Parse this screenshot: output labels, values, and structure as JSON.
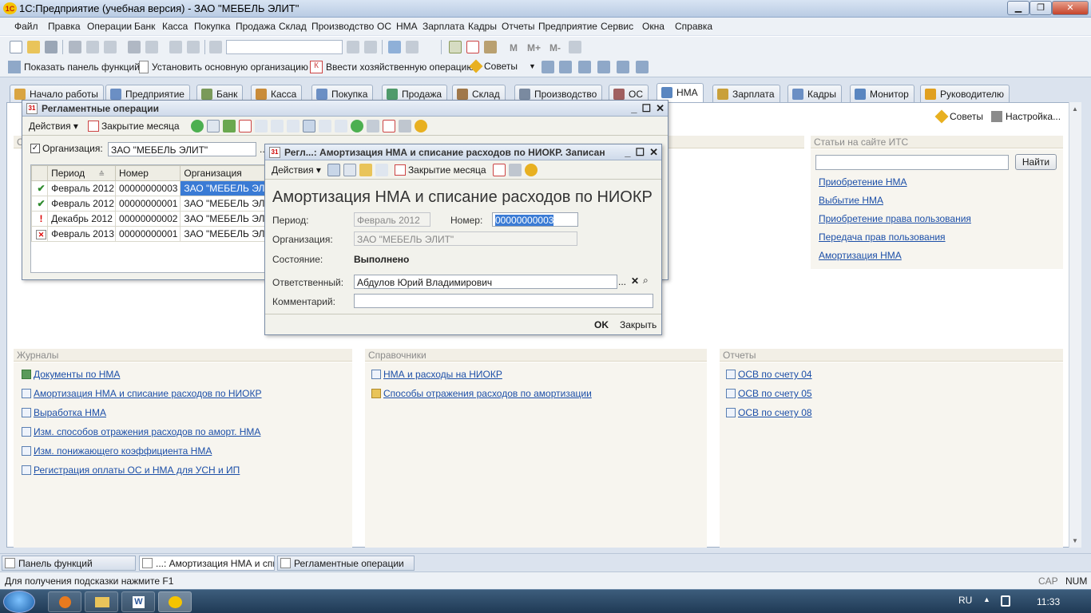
{
  "window": {
    "title": "1С:Предприятие (учебная версия) - ЗАО \"МЕБЕЛЬ ЭЛИТ\"",
    "logo": "1С"
  },
  "menu": [
    "Файл",
    "Правка",
    "Операции",
    "Банк",
    "Касса",
    "Покупка",
    "Продажа",
    "Склад",
    "Производство",
    "ОС",
    "НМА",
    "Зарплата",
    "Кадры",
    "Отчеты",
    "Предприятие",
    "Сервис",
    "Окна",
    "Справка"
  ],
  "toolbar2": {
    "show_panel": "Показать панель функций",
    "set_org": "Установить основную организацию",
    "enter_op": "Ввести хозяйственную операцию",
    "tips": "Советы"
  },
  "toolbar1": {
    "calc_m": "M",
    "calc_mplus": "M+",
    "calc_mminus": "M-"
  },
  "tabs": [
    {
      "label": "Начало работы",
      "icon": "start-icon",
      "color": "#d9a441"
    },
    {
      "label": "Предприятие",
      "icon": "enterprise-icon",
      "color": "#6b8fc4"
    },
    {
      "label": "Банк",
      "icon": "bank-icon",
      "color": "#7a9a5a"
    },
    {
      "label": "Касса",
      "icon": "cash-icon",
      "color": "#c98c3a"
    },
    {
      "label": "Покупка",
      "icon": "purchase-icon",
      "color": "#6b8fc4"
    },
    {
      "label": "Продажа",
      "icon": "sale-icon",
      "color": "#4f9a6b"
    },
    {
      "label": "Склад",
      "icon": "warehouse-icon",
      "color": "#a0784a"
    },
    {
      "label": "Производство",
      "icon": "production-icon",
      "color": "#7a8aa0"
    },
    {
      "label": "ОС",
      "icon": "fixed-assets-icon",
      "color": "#a06060"
    },
    {
      "label": "НМА",
      "icon": "intangible-icon",
      "color": "#5a86c0"
    },
    {
      "label": "Зарплата",
      "icon": "salary-icon",
      "color": "#c9a03a"
    },
    {
      "label": "Кадры",
      "icon": "staff-icon",
      "color": "#6b8fc4"
    },
    {
      "label": "Монитор",
      "icon": "monitor-icon",
      "color": "#5a86c0"
    },
    {
      "label": "Руководителю",
      "icon": "warning-icon",
      "color": "#e0a020"
    }
  ],
  "main": {
    "tips_label": "Советы",
    "settings_label": "Настройка...",
    "its": {
      "title": "Статьи на сайте ИТС",
      "find": "Найти",
      "search_value": "",
      "links": [
        "Приобретение НМА",
        "Выбытие НМА ",
        "Приобретение права пользования",
        "Передача прав пользования",
        "Амортизация НМА"
      ]
    },
    "journals": {
      "title": "Журналы",
      "links": [
        "Документы по НМА",
        "Амортизация НМА и списание расходов по НИОКР",
        "Выработка НМА",
        "Изм. способов отражения расходов по аморт. НМА",
        "Изм. понижающего коэффициента НМА",
        "Регистрация оплаты ОС и НМА для УСН и ИП"
      ]
    },
    "refs": {
      "title": "Справочники",
      "links": [
        "НМА и расходы на НИОКР",
        "Способы отражения расходов по амортизации"
      ]
    },
    "reports": {
      "title": "Отчеты",
      "links": [
        "ОСВ по счету 04",
        "ОСВ по счету 05",
        "ОСВ по счету 08"
      ]
    },
    "left_section_letter": "С"
  },
  "reg_window": {
    "title": "Регламентные операции",
    "actions": "Действия",
    "close_month": "Закрытие месяца",
    "org_label": "Организация:",
    "org_value": "ЗАО \"МЕБЕЛЬ ЭЛИТ\"",
    "columns": [
      "Период",
      "Номер",
      "Организация"
    ],
    "rows": [
      {
        "status": "posted",
        "period": "Февраль 2012",
        "number": "00000000003",
        "org": "ЗАО \"МЕБЕЛЬ ЭЛИ"
      },
      {
        "status": "posted",
        "period": "Февраль 2012",
        "number": "00000000001",
        "org": "ЗАО \"МЕБЕЛЬ ЭЛИ"
      },
      {
        "status": "warning",
        "period": "Декабрь 2012",
        "number": "00000000002",
        "org": "ЗАО \"МЕБЕЛЬ ЭЛИ"
      },
      {
        "status": "deleted",
        "period": "Февраль 2013",
        "number": "00000000001",
        "org": "ЗАО \"МЕБЕЛЬ ЭЛИ"
      }
    ]
  },
  "doc_window": {
    "title": "Регл...: Амортизация НМА и списание расходов по НИОКР. Записан",
    "actions": "Действия",
    "close_month": "Закрытие месяца",
    "heading": "Амортизация НМА и списание расходов по НИОКР",
    "period_label": "Период:",
    "period_value": "Февраль 2012",
    "number_label": "Номер:",
    "number_value": "00000000003",
    "org_label": "Организация:",
    "org_value": "ЗАО \"МЕБЕЛЬ ЭЛИТ\"",
    "state_label": "Состояние:",
    "state_value": "Выполнено",
    "resp_label": "Ответственный:",
    "resp_value": "Абдулов Юрий Владимирович",
    "comment_label": "Комментарий:",
    "comment_value": "",
    "ok": "OK",
    "close": "Закрыть"
  },
  "winbar": [
    "Панель функций",
    "...: Амортизация НМА и спи...",
    "Регламентные операции"
  ],
  "status": {
    "hint": "Для получения подсказки нажмите F1",
    "cap": "CAP",
    "num": "NUM"
  },
  "taskbar": {
    "lang": "RU",
    "time": "11:33"
  }
}
